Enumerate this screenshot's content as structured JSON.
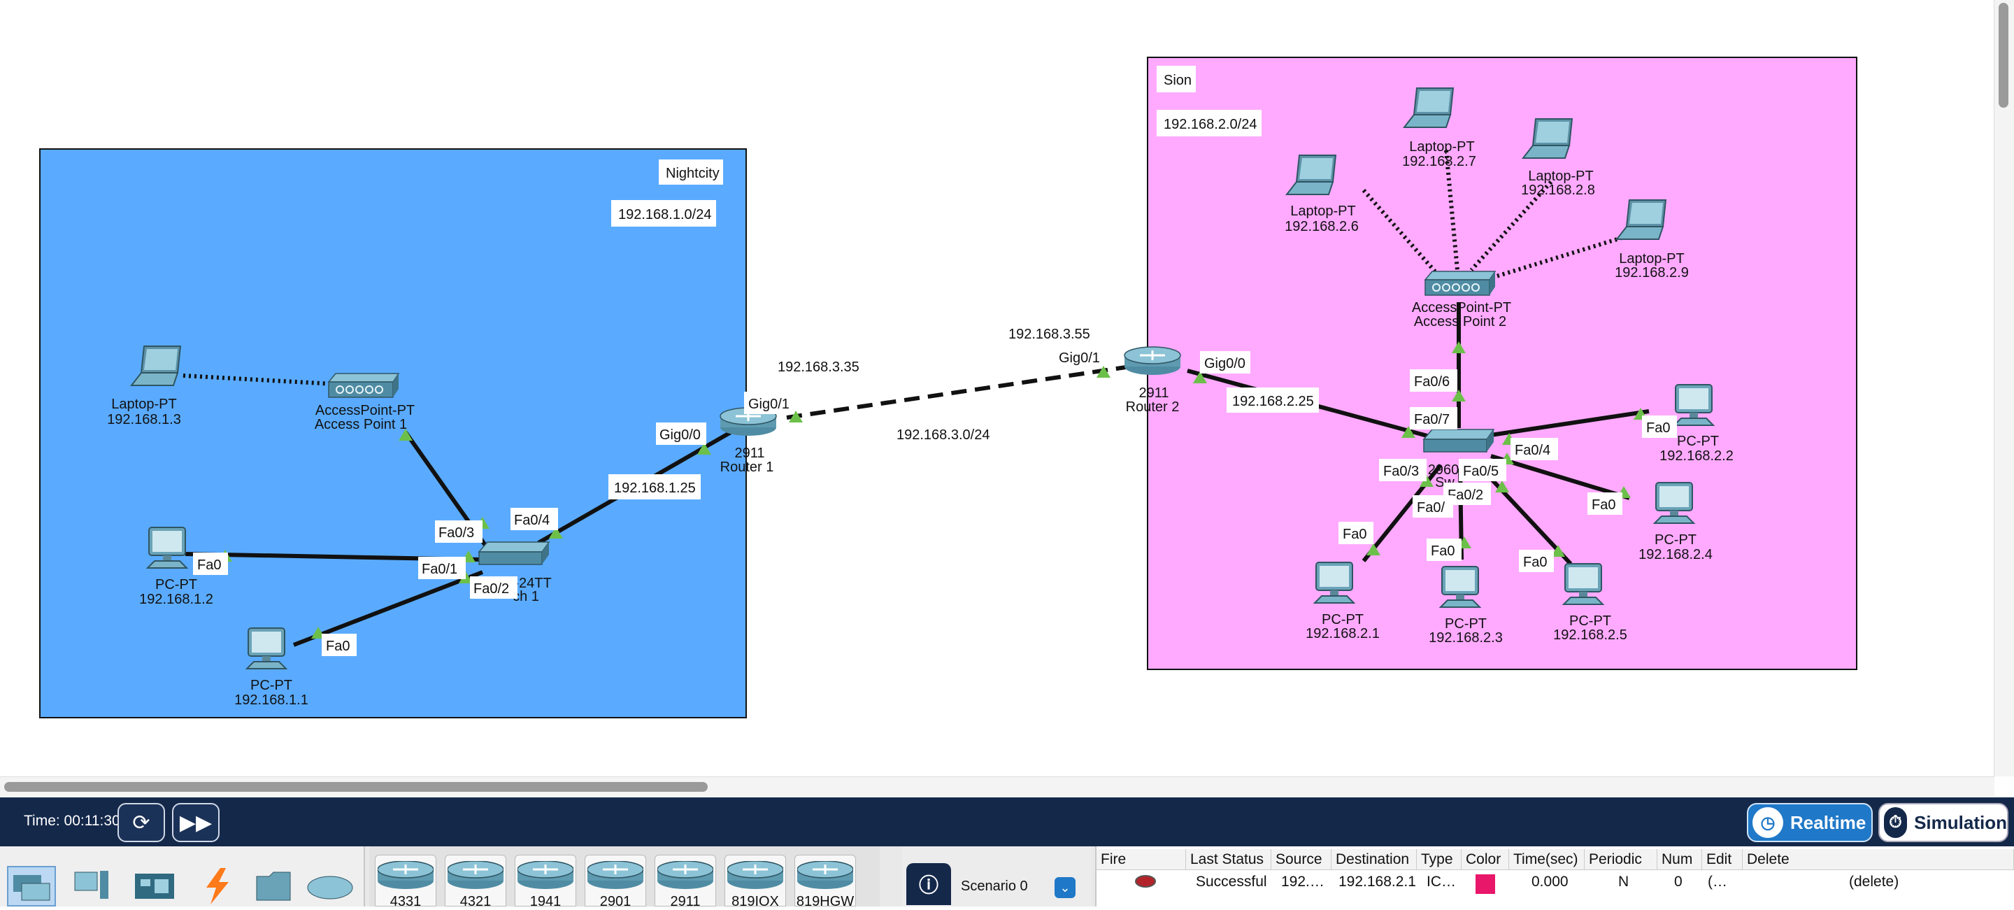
{
  "clusters": {
    "nightcity": {
      "name": "Nightcity",
      "subnet": "192.168.1.0/24",
      "color": "#5aabff"
    },
    "sion": {
      "name": "Sion",
      "subnet": "192.168.2.0/24",
      "color": "#ffaaff"
    }
  },
  "wan": {
    "subnet": "192.168.3.0/24",
    "router1_ip": "192.168.3.35",
    "router2_ip": "192.168.3.55"
  },
  "devices": {
    "laptop1": {
      "type": "Laptop-PT",
      "ip": "192.168.1.3"
    },
    "ap1": {
      "type": "AccessPoint-PT",
      "name": "Access Point 1"
    },
    "pc1_2": {
      "type": "PC-PT",
      "ip": "192.168.1.2"
    },
    "pc1_1": {
      "type": "PC-PT",
      "ip": "192.168.1.1"
    },
    "switch1": {
      "model": "-24TT",
      "name": "ch 1"
    },
    "router1": {
      "model": "2911",
      "name": "Router 1"
    },
    "router2": {
      "model": "2911",
      "name": "Router 2"
    },
    "ap2": {
      "type": "AccessPoint-PT",
      "name": "Access Point 2"
    },
    "laptop2_6": {
      "type": "Laptop-PT",
      "ip": "192.168.2.6"
    },
    "laptop2_7": {
      "type": "Laptop-PT",
      "ip": "192.168.2.7"
    },
    "laptop2_8": {
      "type": "Laptop-PT",
      "ip": "192.168.2.8"
    },
    "laptop2_9": {
      "type": "Laptop-PT",
      "ip": "192.168.2.9"
    },
    "switch2": {
      "model": "2960",
      "name": "Sw"
    },
    "pc2_2": {
      "type": "PC-PT",
      "ip": "192.168.2.2"
    },
    "pc2_4": {
      "type": "PC-PT",
      "ip": "192.168.2.4"
    },
    "pc2_1": {
      "type": "PC-PT",
      "ip": "192.168.2.1"
    },
    "pc2_3": {
      "type": "PC-PT",
      "ip": "192.168.2.3"
    },
    "pc2_5": {
      "type": "PC-PT",
      "ip": "192.168.2.5"
    }
  },
  "gateways": {
    "r1_lan": "192.168.1.25",
    "r2_lan": "192.168.2.25"
  },
  "ports": {
    "fa0": "Fa0",
    "fa01": "Fa0/1",
    "fa02": "Fa0/2",
    "fa03": "Fa0/3",
    "fa04": "Fa0/4",
    "fa05": "Fa0/5",
    "fa06": "Fa0/6",
    "fa07": "Fa0/7",
    "fa0_partial": "Fa0/",
    "gig00": "Gig0/0",
    "gig01": "Gig0/1"
  },
  "toolbar": {
    "time_label": "Time: 00:11:30",
    "realtime_label": "Realtime",
    "simulation_label": "Simulation",
    "reset_icon": "reset-clock-icon",
    "fastforward_icon": "fast-forward-icon"
  },
  "device_tiles": [
    "4331",
    "4321",
    "1941",
    "2901",
    "2911",
    "819IOX",
    "819HGW"
  ],
  "scenario": {
    "label": "Scenario 0"
  },
  "pdu_table": {
    "headers": [
      "Fire",
      "Last Status",
      "Source",
      "Destination",
      "Type",
      "Color",
      "Time(sec)",
      "Periodic",
      "Num",
      "Edit",
      "Delete"
    ],
    "row": {
      "status": "Successful",
      "source": "192.…",
      "destination": "192.168.2.1",
      "type": "IC…",
      "color": "#e8176a",
      "time": "0.000",
      "periodic": "N",
      "num": "0",
      "edit": "(…",
      "delete": "(delete)"
    }
  }
}
